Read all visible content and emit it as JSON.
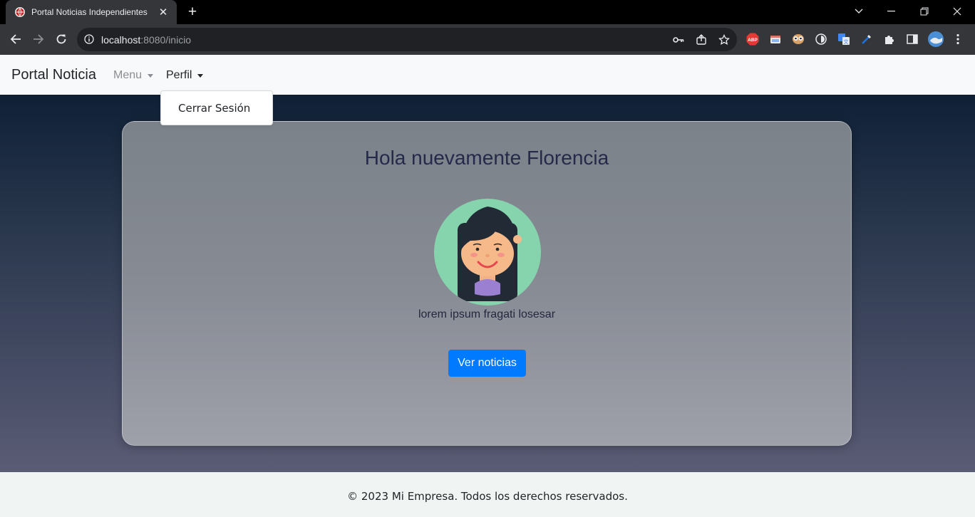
{
  "browser": {
    "tab_title": "Portal Noticias Independientes",
    "url_host": "localhost",
    "url_rest": ":8080/inicio",
    "extension_badge": "ABP"
  },
  "navbar": {
    "brand": "Portal Noticia",
    "menu_label": "Menu",
    "perfil_label": "Perfil"
  },
  "dropdown": {
    "items": [
      {
        "label": "Cerrar Sesión"
      }
    ]
  },
  "card": {
    "greeting": "Hola nuevamente Florencia",
    "bio": "lorem ipsum fragati losesar",
    "button_label": "Ver noticias"
  },
  "footer": {
    "text": "© 2023 Mi Empresa. Todos los derechos reservados."
  },
  "colors": {
    "primary": "#007bff",
    "navbar_bg": "#f8f9fa",
    "avatar_bg": "#86d4ad"
  }
}
